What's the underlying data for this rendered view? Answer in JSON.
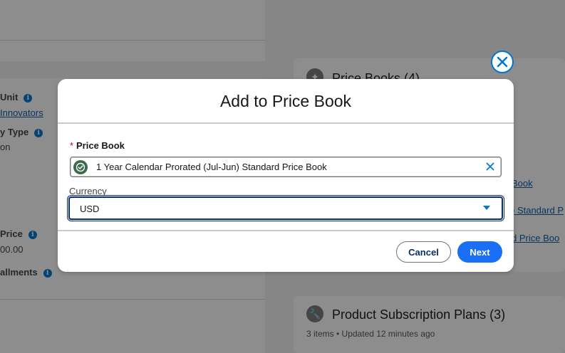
{
  "background": {
    "left_fields": [
      {
        "label": "Unit",
        "has_info": true
      },
      {
        "link": "Innovators"
      },
      {
        "label": "y Type",
        "has_info": true
      },
      {
        "text": "on"
      },
      {
        "label": "Price",
        "has_info": true
      },
      {
        "text": "00.00"
      },
      {
        "label": "allments",
        "has_info": true
      }
    ],
    "price_books_card": {
      "title": "Price Books (4)",
      "links": [
        "Book",
        ") Standard P",
        "d Price Boo"
      ]
    },
    "subscription_card": {
      "title": "Product Subscription Plans (3)",
      "subtitle": "3 items • Updated 12 minutes ago"
    }
  },
  "modal": {
    "title": "Add to Price Book",
    "price_book": {
      "required_marker": "*",
      "label": "Price Book",
      "value": "1 Year Calendar Prorated (Jul-Jun) Standard Price Book"
    },
    "currency": {
      "label": "Currency",
      "value": "USD"
    },
    "buttons": {
      "cancel": "Cancel",
      "next": "Next"
    }
  },
  "colors": {
    "brand_blue": "#0176d3",
    "primary_button": "#1b6ff5",
    "focus_border": "#0b2e63",
    "required_red": "#ba0517"
  },
  "icons": {
    "close": "close-icon",
    "price_book_avatar": "price-book-icon",
    "clear": "clear-icon",
    "dropdown": "chevron-down-icon",
    "card": "wrench-icon"
  }
}
